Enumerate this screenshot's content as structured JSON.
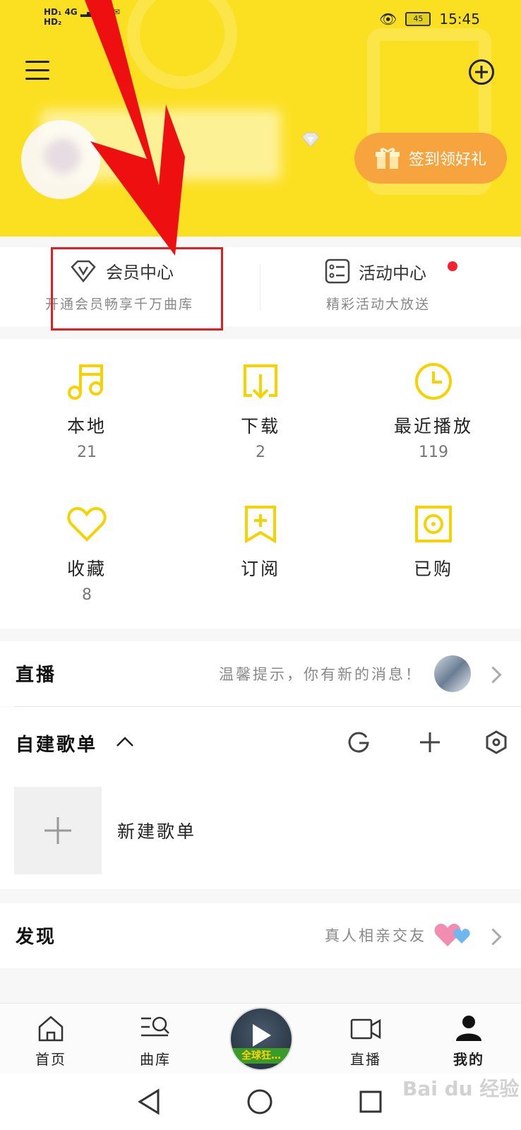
{
  "status_bar": {
    "network": "4G",
    "time": "15:45",
    "battery": "45"
  },
  "header": {
    "signin_label": "签到领好礼"
  },
  "member_row": {
    "vip": {
      "title": "会员中心",
      "subtitle": "开通会员畅享千万曲库"
    },
    "activity": {
      "title": "活动中心",
      "subtitle": "精彩活动大放送"
    }
  },
  "grid": {
    "items": [
      {
        "label": "本地",
        "count": "21",
        "icon": "music-note-icon"
      },
      {
        "label": "下载",
        "count": "2",
        "icon": "download-icon"
      },
      {
        "label": "最近播放",
        "count": "119",
        "icon": "clock-icon"
      },
      {
        "label": "收藏",
        "count": "8",
        "icon": "heart-icon"
      },
      {
        "label": "订阅",
        "count": "",
        "icon": "bookmark-add-icon"
      },
      {
        "label": "已购",
        "count": "",
        "icon": "disc-icon"
      }
    ]
  },
  "live": {
    "title": "直播",
    "hint": "温馨提示，你有新的消息！"
  },
  "playlists": {
    "title": "自建歌单",
    "new_label": "新建歌单"
  },
  "discover": {
    "title": "发现",
    "hint": "真人相亲交友"
  },
  "tabbar": {
    "tabs": [
      "首页",
      "曲库",
      "直播",
      "我的"
    ],
    "player_banner": "全球狂…"
  },
  "watermark": "Bai du 经验",
  "colors": {
    "header_yellow": "#fbe022",
    "accent_yellow": "#f5d300",
    "signin_orange": "#f7a43f",
    "highlight_red": "#e02020"
  }
}
